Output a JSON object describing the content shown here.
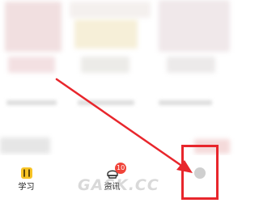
{
  "tabbar": {
    "tabs": [
      {
        "label": "学习",
        "icon": "book-icon"
      },
      {
        "label": "资讯",
        "icon": "news-icon",
        "badge": "10"
      },
      {
        "label": "",
        "icon": "profile-icon"
      }
    ]
  },
  "watermark": {
    "text": "GASK.CC"
  },
  "colors": {
    "accent_yellow": "#f7c325",
    "badge_red": "#f0443a",
    "annotation_red": "#e8262c"
  }
}
